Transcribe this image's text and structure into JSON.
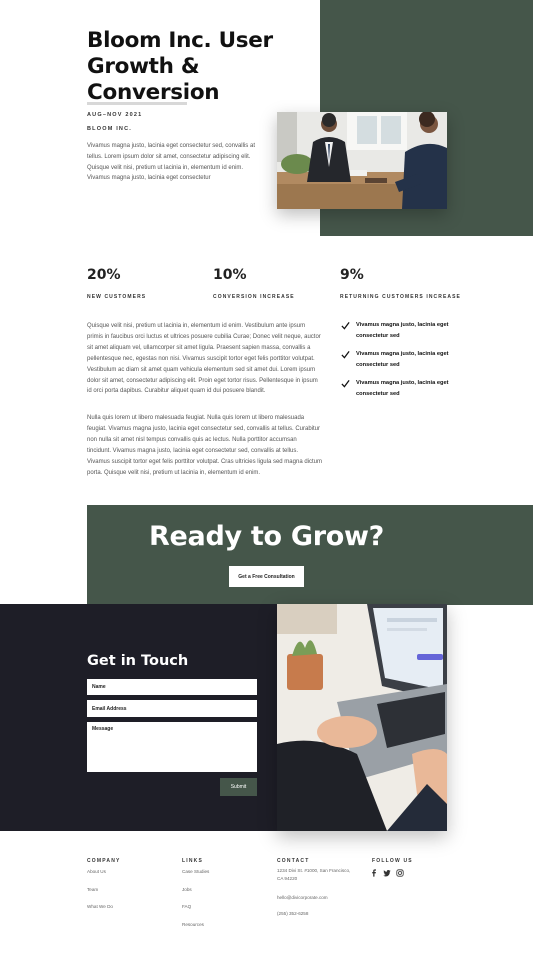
{
  "hero": {
    "title": "Bloom Inc. User Growth & Conversion",
    "date": "AUG–NOV 2021",
    "company": "BLOOM INC.",
    "intro": "Vivamus magna justo, lacinia eget consectetur sed, convallis at tellus. Lorem ipsum dolor sit amet, consectetur adipiscing elit. Quisque velit nisi, pretium ut lacinia in, elementum id enim. Vivamus magna justo, lacinia eget consectetur"
  },
  "stats": [
    {
      "value": "20%",
      "label": "NEW CUSTOMERS"
    },
    {
      "value": "10%",
      "label": "CONVERSION INCREASE"
    },
    {
      "value": "9%",
      "label": "RETURNING CUSTOMERS INCREASE"
    }
  ],
  "body": {
    "paragraph1": "Quisque velit nisi, pretium ut lacinia in, elementum id enim. Vestibulum ante ipsum primis in faucibus orci luctus et ultrices posuere cubilia Curae; Donec velit neque, auctor sit amet aliquam vel, ullamcorper sit amet ligula. Praesent sapien massa, convallis a pellentesque nec, egestas non nisi. Vivamus suscipit tortor eget felis porttitor volutpat. Vestibulum ac diam sit amet quam vehicula elementum sed sit amet dui. Lorem ipsum dolor sit amet, consectetur adipiscing elit. Proin eget tortor risus. Pellentesque in ipsum id orci porta dapibus. Curabitur aliquet quam id dui posuere blandit.",
    "paragraph2": "Nulla quis lorem ut libero malesuada feugiat. Nulla quis lorem ut libero malesuada feugiat. Vivamus magna justo, lacinia eget consectetur sed, convallis at tellus. Curabitur non nulla sit amet nisl tempus convallis quis ac lectus. Nulla porttitor accumsan tincidunt. Vivamus magna justo, lacinia eget consectetur sed, convallis at tellus. Vivamus suscipit tortor eget felis porttitor volutpat. Cras ultricies ligula sed magna dictum porta. Quisque velit nisi, pretium ut lacinia in, elementum id enim."
  },
  "checklist": [
    "Vivamus magna justo, lacinia eget consectetur sed",
    "Vivamus magna justo, lacinia eget consectetur sed",
    "Vivamus magna justo, lacinia eget consectetur sed"
  ],
  "cta": {
    "title": "Ready to Grow?",
    "button_label": "Get a Free Consultation"
  },
  "contact": {
    "title": "Get in Touch",
    "name_placeholder": "Name",
    "email_placeholder": "Email Address",
    "message_placeholder": "Message",
    "submit_label": "Submit"
  },
  "footer": {
    "company": {
      "heading": "COMPANY",
      "links": [
        "About Us",
        "Team",
        "What We Do"
      ]
    },
    "links": {
      "heading": "LINKS",
      "links": [
        "Case Studies",
        "Jobs",
        "FAQ",
        "Resources"
      ]
    },
    "contact": {
      "heading": "CONTACT",
      "address": "1234 Divi St. #1000, San Francisco, CA 94220",
      "email": "hello@divicorporate.com",
      "phone": "(255) 352-6258"
    },
    "follow": {
      "heading": "FOLLOW US",
      "icons": [
        "facebook-icon",
        "twitter-icon",
        "instagram-icon"
      ]
    }
  },
  "colors": {
    "accent_green": "#45564a",
    "dark_panel": "#1e1e27",
    "text_dark": "#111111",
    "text_muted": "#555555"
  }
}
